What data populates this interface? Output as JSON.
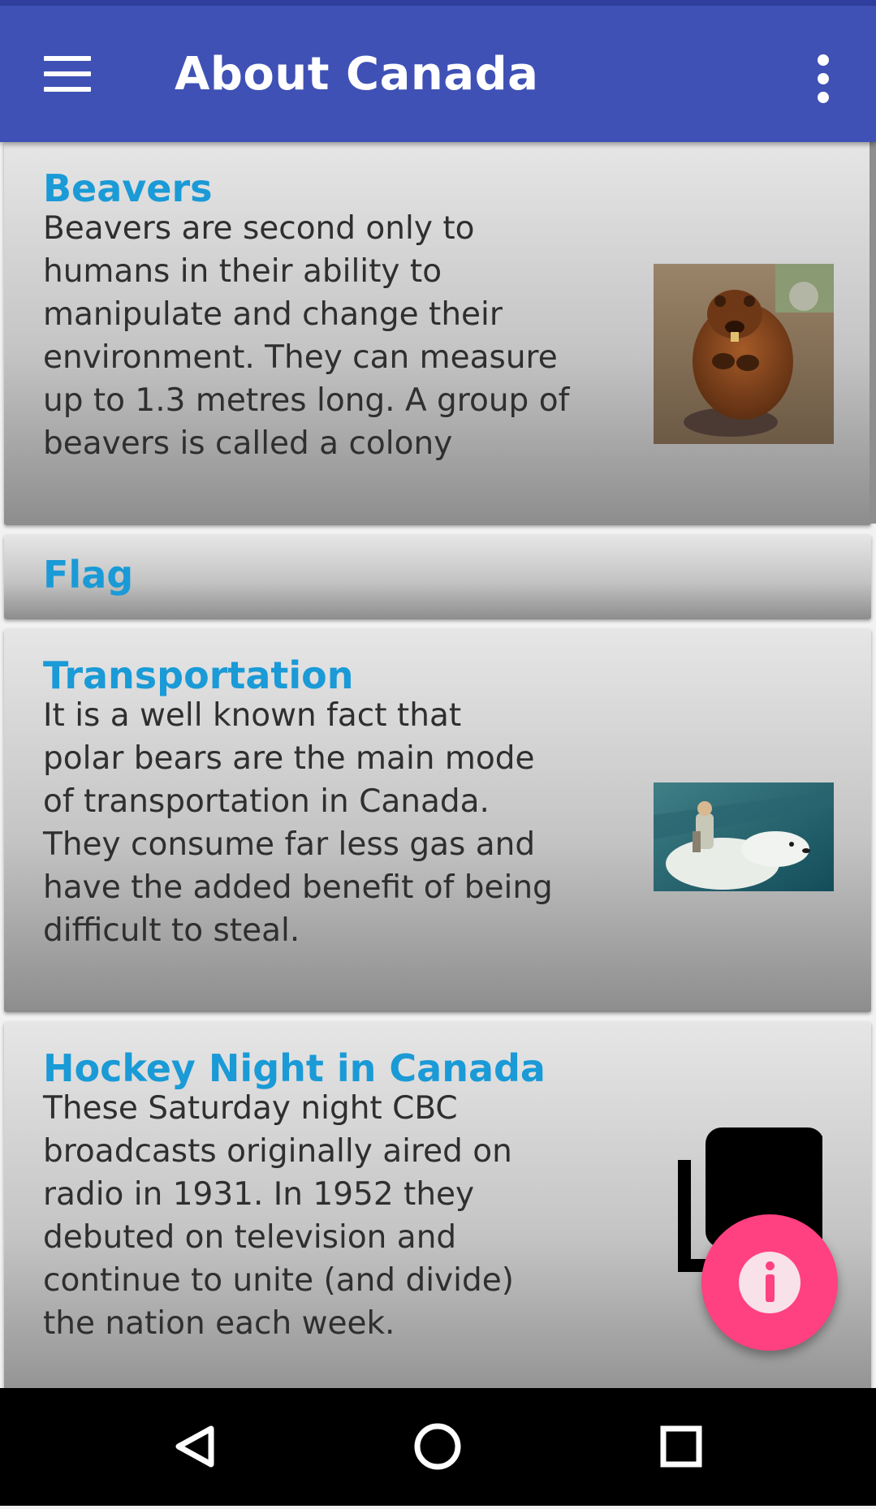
{
  "app_bar": {
    "title": "About Canada",
    "menu_icon": "hamburger-menu-icon",
    "overflow_icon": "more-vertical-icon",
    "color": "#3f51b5"
  },
  "cards": [
    {
      "title": "Beavers",
      "body": "Beavers are second only to\nhumans in their ability to\nmanipulate and change their\nenvironment. They can measure\nup to 1.3 metres long. A group of\nbeavers is called a colony",
      "image": "beaver-photo"
    },
    {
      "title": "Flag"
    },
    {
      "title": "Transportation",
      "body": "It is a well known fact that\npolar bears are the main mode\nof transportation in Canada.\nThey consume far less gas and\nhave the added benefit of being\ndifficult to steal.",
      "image": "polar-bear-rider-photo"
    },
    {
      "title": "Hockey Night in Canada",
      "body": "These Saturday night CBC\nbroadcasts originally aired on\nradio in 1931. In 1952 they\ndebuted on television and\ncontinue to unite (and divide)\nthe nation each week.",
      "image": "copy-placeholder-icon"
    }
  ],
  "fab": {
    "icon": "info-icon",
    "color": "#ff4081"
  },
  "nav_bar": {
    "back": "back-icon",
    "home": "home-icon",
    "recents": "recents-icon"
  },
  "colors": {
    "title_text": "#1a9ad6",
    "body_text": "#2f2f2f"
  }
}
